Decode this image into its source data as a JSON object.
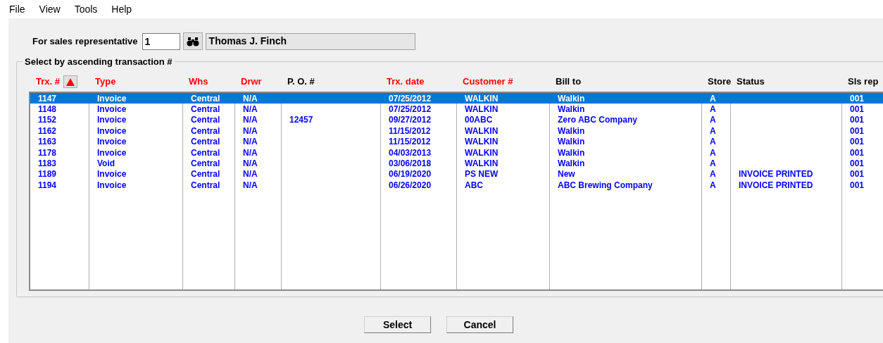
{
  "menu": [
    "File",
    "View",
    "Tools",
    "Help"
  ],
  "rep": {
    "label": "For sales representative",
    "value": "1",
    "name": "Thomas J. Finch"
  },
  "group": {
    "title": "Select by ascending transaction #"
  },
  "table": {
    "columns": [
      {
        "label": "Trx. #",
        "color": "#ff0000"
      },
      {
        "label": "Type",
        "color": "#ff0000"
      },
      {
        "label": "Whs",
        "color": "#ff0000"
      },
      {
        "label": "Drwr",
        "color": "#ff0000"
      },
      {
        "label": "P. O. #",
        "color": "#000000"
      },
      {
        "label": "Trx. date",
        "color": "#ff0000"
      },
      {
        "label": "Customer #",
        "color": "#ff0000"
      },
      {
        "label": "Bill to",
        "color": "#000000"
      },
      {
        "label": "Store",
        "color": "#000000"
      },
      {
        "label": "Status",
        "color": "#000000"
      },
      {
        "label": "Sls rep",
        "color": "#000000"
      }
    ],
    "rows": [
      {
        "selected": true,
        "cells": [
          "1147",
          "Invoice",
          "Central",
          "N/A",
          "",
          "07/25/2012",
          "WALKIN",
          "Walkin",
          "A",
          "",
          "001"
        ]
      },
      {
        "selected": false,
        "cells": [
          "1148",
          "Invoice",
          "Central",
          "N/A",
          "",
          "07/25/2012",
          "WALKIN",
          "Walkin",
          "A",
          "",
          "001"
        ]
      },
      {
        "selected": false,
        "cells": [
          "1152",
          "Invoice",
          "Central",
          "N/A",
          "12457",
          "09/27/2012",
          "00ABC",
          "Zero ABC Company",
          "A",
          "",
          "001"
        ]
      },
      {
        "selected": false,
        "cells": [
          "1162",
          "Invoice",
          "Central",
          "N/A",
          "",
          "11/15/2012",
          "WALKIN",
          "Walkin",
          "A",
          "",
          "001"
        ]
      },
      {
        "selected": false,
        "cells": [
          "1163",
          "Invoice",
          "Central",
          "N/A",
          "",
          "11/15/2012",
          "WALKIN",
          "Walkin",
          "A",
          "",
          "001"
        ]
      },
      {
        "selected": false,
        "cells": [
          "1178",
          "Invoice",
          "Central",
          "N/A",
          "",
          "04/03/2013",
          "WALKIN",
          "Walkin",
          "A",
          "",
          "001"
        ]
      },
      {
        "selected": false,
        "cells": [
          "1183",
          "Void",
          "Central",
          "N/A",
          "",
          "03/06/2018",
          "WALKIN",
          "Walkin",
          "A",
          "",
          "001"
        ]
      },
      {
        "selected": false,
        "cells": [
          "1189",
          "Invoice",
          "Central",
          "N/A",
          "",
          "06/19/2020",
          "PS NEW",
          "New",
          "A",
          "INVOICE PRINTED",
          "001"
        ]
      },
      {
        "selected": false,
        "cells": [
          "1194",
          "Invoice",
          "Central",
          "N/A",
          "",
          "06/26/2020",
          "ABC",
          "ABC Brewing Company",
          "A",
          "INVOICE PRINTED",
          "001"
        ]
      }
    ]
  },
  "buttons": [
    "Select",
    "Cancel"
  ]
}
